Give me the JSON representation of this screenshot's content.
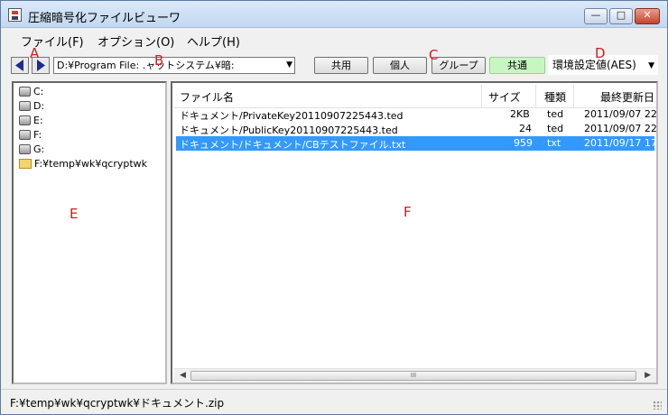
{
  "window": {
    "title": "圧縮暗号化ファイルビューワ",
    "buttons": {
      "minimize": "—",
      "maximize": "□",
      "close": "✕"
    }
  },
  "menu": [
    "ファイル(F)",
    "オプション(O)",
    "ヘルプ(H)"
  ],
  "toolbar": {
    "path": "D:¥Program File: .ャットシステム¥暗:",
    "buttons": [
      "共用",
      "個人",
      "グループ",
      "共通"
    ],
    "active_button": "共通",
    "algorithm": "環境設定値(AES)"
  },
  "markers": [
    "A",
    "B",
    "C",
    "D",
    "E",
    "F"
  ],
  "tree": [
    {
      "label": "C:",
      "icon": "drive-icon"
    },
    {
      "label": "D:",
      "icon": "drive-icon"
    },
    {
      "label": "E:",
      "icon": "cdrom-icon"
    },
    {
      "label": "F:",
      "icon": "drive-icon"
    },
    {
      "label": "G:",
      "icon": "cdrom-icon"
    },
    {
      "label": "F:¥temp¥wk¥qcryptwk",
      "icon": "folder-icon"
    }
  ],
  "list": {
    "columns": [
      "ファイル名",
      "サイズ",
      "種類",
      "最終更新日"
    ],
    "rows": [
      {
        "name": "ドキュメント/PrivateKey20110907225443.ted",
        "size": "2KB",
        "type": "ted",
        "date": "2011/09/07 22"
      },
      {
        "name": "ドキュメント/PublicKey20110907225443.ted",
        "size": "24",
        "type": "ted",
        "date": "2011/09/07 22"
      },
      {
        "name": "ドキュメント/ドキュメント/CBテストファイル.txt",
        "size": "959",
        "type": "txt",
        "date": "2011/09/17 17"
      }
    ],
    "selected_index": 2,
    "scroll_thumb": "III"
  },
  "status": "F:¥temp¥wk¥qcryptwk¥ドキュメント.zip",
  "colors": {
    "selection": "#3399ff",
    "marker": "#c81e1e",
    "active_button": "#c9f5c3"
  }
}
